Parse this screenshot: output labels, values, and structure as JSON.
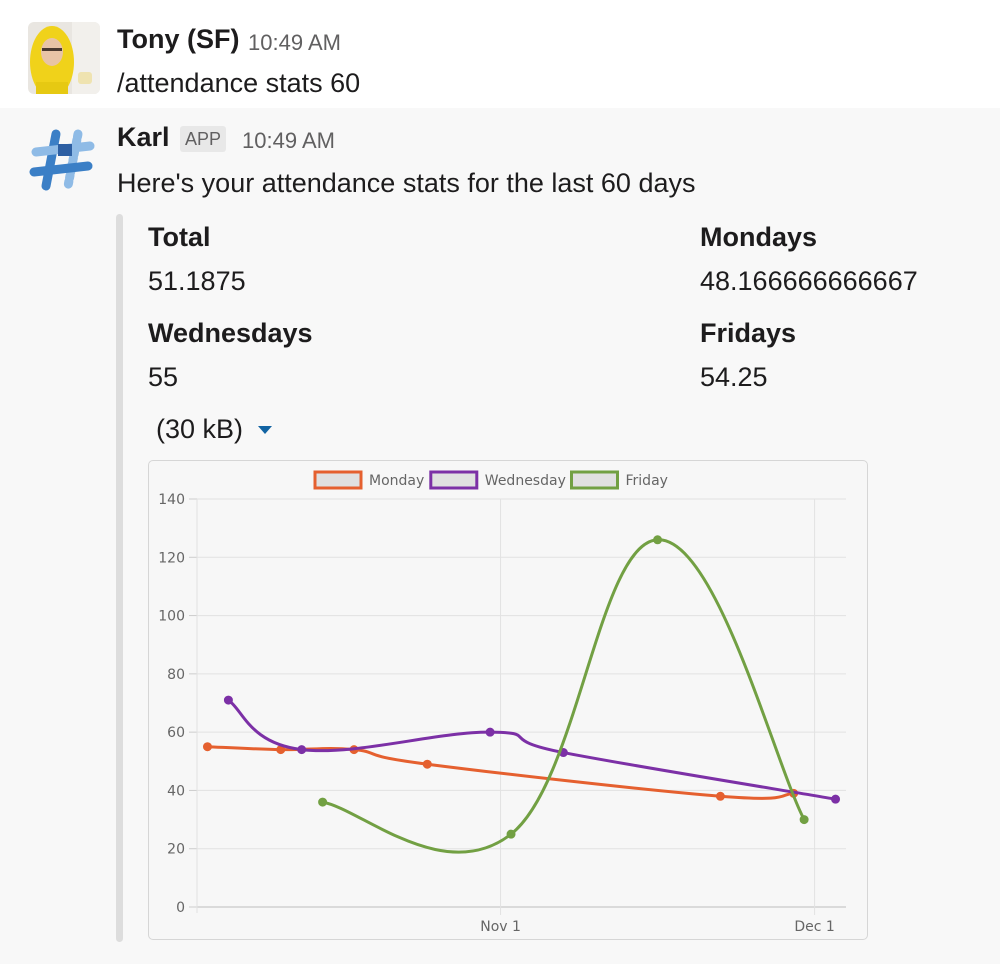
{
  "messages": [
    {
      "sender": "Tony (SF)",
      "time": "10:49 AM",
      "text": "/attendance stats 60"
    },
    {
      "sender": "Karl",
      "badge": "APP",
      "time": "10:49 AM",
      "text": "Here's your attendance stats for the last 60 days",
      "fields": [
        {
          "title": "Total",
          "value": "51.1875"
        },
        {
          "title": "Mondays",
          "value": "48.166666666667"
        },
        {
          "title": "Wednesdays",
          "value": "55"
        },
        {
          "title": "Fridays",
          "value": "54.25"
        }
      ],
      "file_size": "(30 kB)"
    }
  ],
  "colors": {
    "monday": "#e5602f",
    "wednesday": "#7c30a6",
    "friday": "#72a043",
    "dropdown_caret": "#1264a3"
  },
  "icons": {
    "avatar_tony": "user-photo-avatar",
    "avatar_karl": "slack-hash-logo",
    "caret": "caret-down-icon"
  },
  "chart_data": {
    "type": "line",
    "xlabel": "",
    "ylabel": "",
    "ylim": [
      0,
      140
    ],
    "yticks": [
      "0",
      "20",
      "40",
      "60",
      "80",
      "100",
      "120",
      "140"
    ],
    "x_tick_labels": [
      "Nov 1",
      "Dec 1"
    ],
    "grid": true,
    "legend_position": "top-center",
    "series": [
      {
        "name": "Monday",
        "color": "#e5602f",
        "points": [
          {
            "x": "Oct 4",
            "y": 55
          },
          {
            "x": "Oct 11",
            "y": 54
          },
          {
            "x": "Oct 18",
            "y": 54
          },
          {
            "x": "Oct 25",
            "y": 49
          },
          {
            "x": "Nov 22",
            "y": 38
          },
          {
            "x": "Nov 29",
            "y": 39
          }
        ]
      },
      {
        "name": "Wednesday",
        "color": "#7c30a6",
        "points": [
          {
            "x": "Oct 6",
            "y": 71
          },
          {
            "x": "Oct 13",
            "y": 54
          },
          {
            "x": "Oct 31",
            "y": 60
          },
          {
            "x": "Nov 7",
            "y": 53
          },
          {
            "x": "Dec 3",
            "y": 37
          }
        ]
      },
      {
        "name": "Friday",
        "color": "#72a043",
        "points": [
          {
            "x": "Oct 15",
            "y": 36
          },
          {
            "x": "Nov 2",
            "y": 25
          },
          {
            "x": "Nov 16",
            "y": 126
          },
          {
            "x": "Nov 30",
            "y": 30
          }
        ]
      }
    ]
  }
}
